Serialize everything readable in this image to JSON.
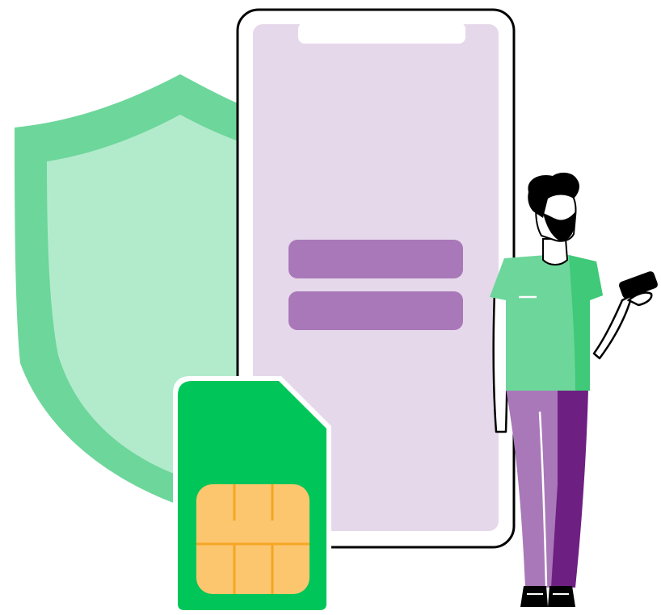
{
  "illustration": {
    "colors": {
      "shield_outer": "#6dd69a",
      "shield_inner": "#b2ebcc",
      "phone_screen": "#e6d8eb",
      "phone_frame": "#000000",
      "screen_bars": "#a978b8",
      "sim_body": "#00c65a",
      "sim_chip": "#fcc66e",
      "sim_chip_lines": "#f5a623",
      "shirt": "#6dd69a",
      "shirt_shade": "#3fc978",
      "pants_light": "#a978b8",
      "pants_dark": "#6e1f82",
      "hair_beard": "#000000"
    },
    "icons": [
      "shield-icon",
      "smartphone-icon",
      "sim-card-icon",
      "person-figure"
    ]
  }
}
